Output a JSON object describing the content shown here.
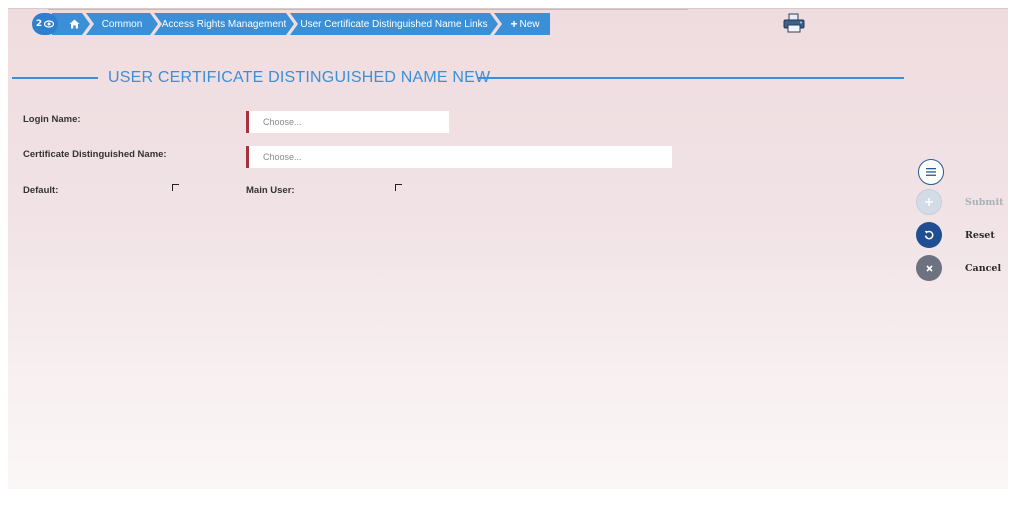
{
  "breadcrumb": {
    "counter": "2",
    "items": [
      {
        "label": "Common"
      },
      {
        "label": "Access Rights Management"
      },
      {
        "label": "User Certificate Distinguished Name Links"
      },
      {
        "label": "New"
      }
    ],
    "new_prefix": "+"
  },
  "page": {
    "title": "USER CERTIFICATE DISTINGUISHED NAME NEW"
  },
  "form": {
    "login_name": {
      "label": "Login Name:",
      "placeholder": "Choose...",
      "value": ""
    },
    "certificate_dn": {
      "label": "Certificate Distinguished Name:",
      "placeholder": "Choose...",
      "value": ""
    },
    "default": {
      "label": "Default:",
      "checked": false
    },
    "main_user": {
      "label": "Main User:",
      "checked": false
    }
  },
  "actions": {
    "submit": {
      "label": "Submit",
      "enabled": false
    },
    "reset": {
      "label": "Reset"
    },
    "cancel": {
      "label": "Cancel"
    }
  },
  "colors": {
    "accent": "#3a8fd6",
    "mandatory_marker": "#a6323b",
    "reset": "#1f4e92",
    "cancel": "#6d7280",
    "disabled_text": "#a9b0b8"
  },
  "icons": [
    "eye-icon",
    "home-icon",
    "printer-icon",
    "menu-icon",
    "plus-icon",
    "undo-icon",
    "close-icon"
  ]
}
